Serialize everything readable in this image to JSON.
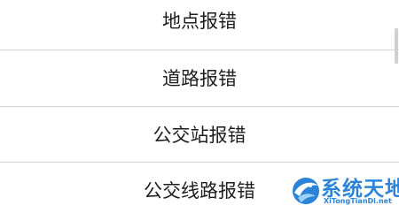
{
  "menu": {
    "items": [
      {
        "label": "地点报错"
      },
      {
        "label": "道路报错"
      },
      {
        "label": "公交站报错"
      },
      {
        "label": "公交线路报错"
      }
    ]
  },
  "watermark": {
    "title": "系统天地",
    "url": "XiTongTianDi.net",
    "icon": "bird-swirl-logo",
    "color": "#2b84d8"
  }
}
